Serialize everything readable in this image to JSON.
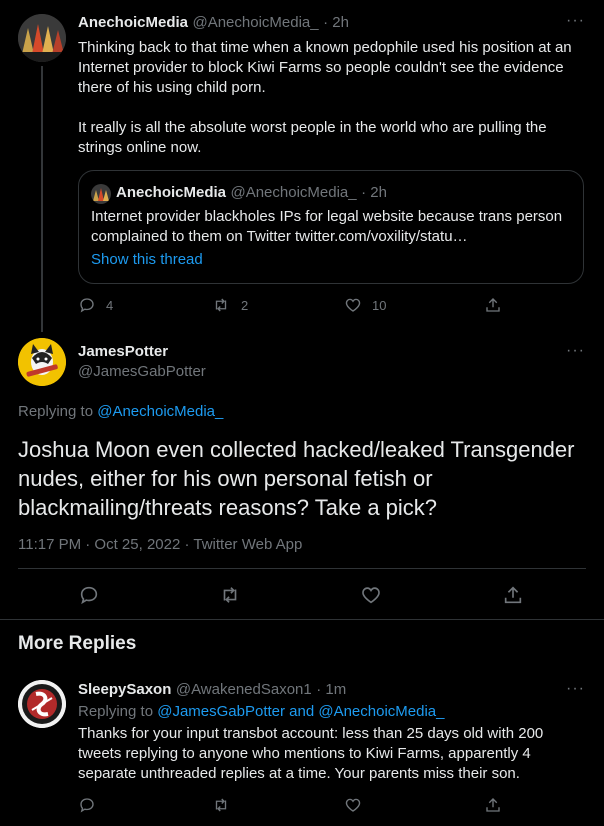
{
  "tweet1": {
    "author_name": "AnechoicMedia",
    "handle": "@AnechoicMedia_",
    "time": "· 2h",
    "text_p1": "Thinking back to that time when a known pedophile used his position at an Internet provider to block Kiwi Farms so people couldn't see the evidence there of his using child porn.",
    "text_p2": "It really is all the absolute worst people in the world who are pulling the strings online now.",
    "quote": {
      "author_name": "AnechoicMedia",
      "handle": "@AnechoicMedia_",
      "time": "· 2h",
      "text": "Internet provider blackholes IPs for legal website because trans person complained to them on Twitter twitter.com/voxility/statu…",
      "show_thread": "Show this thread"
    },
    "replies": "4",
    "retweets": "2",
    "likes": "10"
  },
  "tweet2": {
    "author_name": "JamesPotter",
    "handle": "@JamesGabPotter",
    "replying_to_label": "Replying to",
    "replying_to": "@AnechoicMedia_",
    "text": "Joshua Moon even collected hacked/leaked Transgender nudes, either for his own personal fetish or blackmailing/threats reasons? Take a pick?",
    "timestamp": "11:17 PM · Oct 25, 2022 · Twitter Web App"
  },
  "more_replies_heading": "More Replies",
  "tweet3": {
    "author_name": "SleepySaxon",
    "handle": "@AwakenedSaxon1",
    "time": "· 1m",
    "replying_to_label": "Replying to",
    "replying_to": "@JamesGabPotter and @AnechoicMedia_",
    "text": "Thanks for your input transbot account: less than 25 days old with 200 tweets replying to anyone who mentions to Kiwi Farms, apparently 4 separate unthreaded replies at a time. Your parents miss their son."
  },
  "more_icon": "···"
}
